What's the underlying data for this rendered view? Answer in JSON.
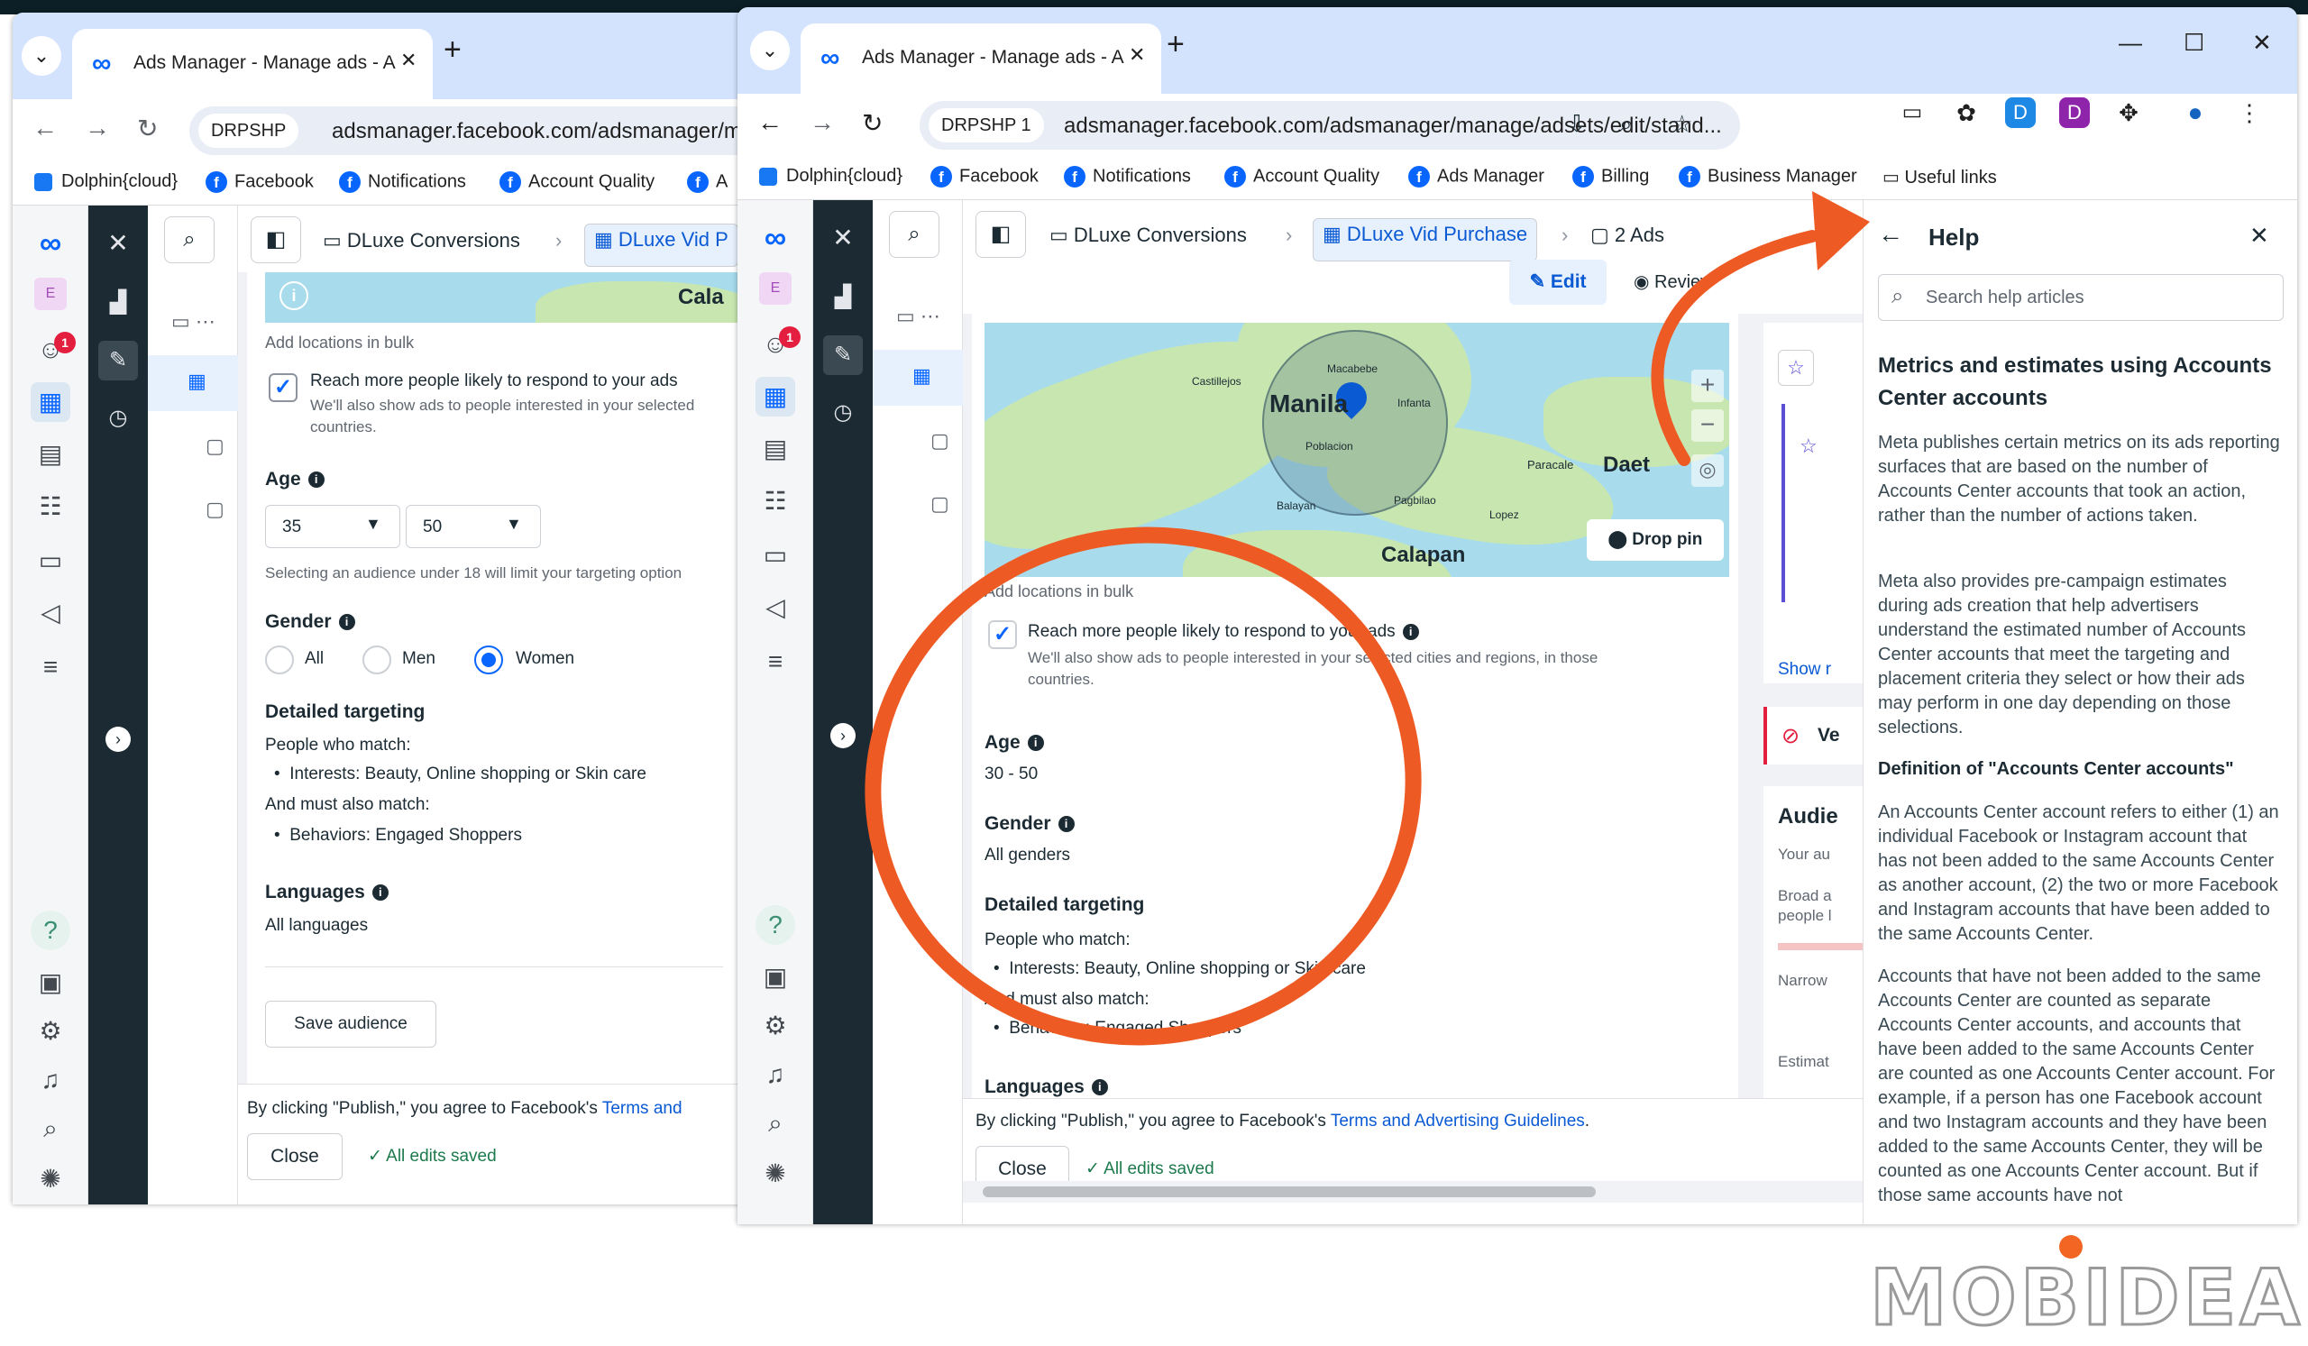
{
  "left_window": {
    "tab": {
      "title": "Ads Manager - Manage ads - A",
      "close": "✕"
    },
    "new_tab": "+",
    "tab_dropdown": "⌄",
    "site_chip": "DRPSHP",
    "url": "adsmanager.facebook.com/adsmanager/ma",
    "bookmarks": [
      "Dolphin{cloud}",
      "Facebook",
      "Notifications",
      "Account Quality",
      "A"
    ],
    "breadcrumb": {
      "campaign": "DLuxe Conversions",
      "adset": "DLuxe Vid P"
    },
    "map_label": "Cala",
    "add_locations": "Add locations in bulk",
    "reach_more": {
      "label": "Reach more people likely to respond to your ads",
      "sub": "We'll also show ads to people interested in your selected",
      "sub2": "countries."
    },
    "age": {
      "label": "Age",
      "min": "35",
      "max": "50",
      "note": "Selecting an audience under 18 will limit your targeting option"
    },
    "gender": {
      "label": "Gender",
      "options": [
        "All",
        "Men",
        "Women"
      ],
      "selected": "Women"
    },
    "detailed": {
      "title": "Detailed targeting",
      "match": "People who match:",
      "interests": "Interests: Beauty, Online shopping or Skin care",
      "also": "And must also match:",
      "behaviors": "Behaviors: Engaged Shoppers"
    },
    "languages": {
      "label": "Languages",
      "value": "All languages"
    },
    "save_audience": "Save audience",
    "footer": {
      "agree": "By clicking \"Publish,\" you agree to Facebook's ",
      "terms": "Terms and",
      "close": "Close",
      "saved": "All edits saved"
    },
    "notif_count": "1",
    "avatar_letter": "E"
  },
  "right_window": {
    "tab": {
      "title": "Ads Manager - Manage ads - A",
      "close": "✕"
    },
    "new_tab": "+",
    "tab_dropdown": "⌄",
    "site_chip": "DRPSHP 1",
    "url": "adsmanager.facebook.com/adsmanager/manage/adsets/edit/stand...",
    "window_controls": {
      "minimize": "—",
      "maximize": "☐",
      "close": "✕"
    },
    "bookmarks": [
      "Dolphin{cloud}",
      "Facebook",
      "Notifications",
      "Account Quality",
      "Ads Manager",
      "Billing",
      "Business Manager",
      "Useful links"
    ],
    "breadcrumb": {
      "campaign": "DLuxe Conversions",
      "adset": "DLuxe Vid Purchase",
      "ads": "2 Ads"
    },
    "edit": "Edit",
    "review": "Review",
    "map": {
      "labels": [
        "Macabebe",
        "Castillejos",
        "Manila",
        "Infanta",
        "Poblacion",
        "Balayan",
        "Pagbilao",
        "Paracale",
        "Daet",
        "Lopez",
        "Calapan"
      ],
      "drop_pin": "Drop pin",
      "zoom_in": "+",
      "zoom_out": "−"
    },
    "add_locations": "Add locations in bulk",
    "reach_more": {
      "label": "Reach more people likely to respond to your ads",
      "sub": "We'll also show ads to people interested in your selected cities and regions, in those",
      "sub2": "countries."
    },
    "age": {
      "label": "Age",
      "value": "30 - 50"
    },
    "gender": {
      "label": "Gender",
      "value": "All genders"
    },
    "detailed": {
      "title": "Detailed targeting",
      "match": "People who match:",
      "interests": "Interests: Beauty, Online shopping or Skin care",
      "also": "And must also match:",
      "behaviors": "Behaviors: Engaged Shoppers"
    },
    "languages": {
      "label": "Languages"
    },
    "side_panel": {
      "show": "Show r",
      "ve": "Ve",
      "audience": "Audie",
      "your_au": "Your au",
      "broad": "Broad a",
      "people": "people l",
      "narrow": "Narrow",
      "estimate": "Estimat"
    },
    "footer": {
      "agree": "By clicking \"Publish,\" you agree to Facebook's ",
      "terms": "Terms and Advertising Guidelines",
      "period": ".",
      "close": "Close",
      "saved": "All edits saved"
    },
    "notif_count": "1",
    "avatar_letter": "E"
  },
  "help": {
    "title": "Help",
    "search_placeholder": "Search help articles",
    "article_title": "Metrics and estimates using Accounts Center accounts",
    "p1": "Meta publishes certain metrics on its ads reporting surfaces that are based on the number of Accounts Center accounts that took an action, rather than the number of actions taken.",
    "p2": "Meta also provides pre-campaign estimates during ads creation that help advertisers understand the estimated number of Accounts Center accounts that meet the targeting and placement criteria they select or how their ads may perform in one day depending on those selections.",
    "subtitle": "Definition of \"Accounts Center accounts\"",
    "p3": "An Accounts Center account refers to either (1) an individual Facebook or Instagram account that has not been added to the same Accounts Center as another account, (2) the two or more Facebook and Instagram accounts that have been added to the same Accounts Center.",
    "p4": "Accounts that have not been added to the same Accounts Center are counted as separate Accounts Center accounts, and accounts that have been added to the same Accounts Center are counted as one Accounts Center account. For example, if a person has one Facebook account and two Instagram accounts and they have been added to the same Accounts Center, they will be counted as one Accounts Center account. But if those same accounts have not"
  },
  "watermark": "MOBIDEA",
  "colors": {
    "accent": "#0866ff",
    "annotation": "#ee5a24",
    "dark_rail": "#1c2b33",
    "chrome_tab": "#d3e3fd"
  }
}
